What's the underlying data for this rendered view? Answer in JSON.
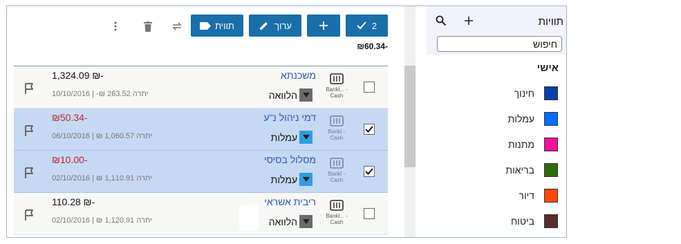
{
  "toolbar": {
    "confirm_count": "2",
    "edit_label": "ערוך",
    "tags_label": "תווית"
  },
  "total": "-₪60.34",
  "transactions": [
    {
      "payee": "משכנתא",
      "account": "Bankl... - Cash",
      "category": "הלוואה",
      "category_color": "#6b6b6b",
      "amount": "-₪ 1,324.09",
      "negative": false,
      "balance": "יתרה 263.52 ₪- | 10/10/2016",
      "checked": false,
      "selected": false
    },
    {
      "payee": "דמי ניהול נ\"ע",
      "account": "Bankl - Cash",
      "category": "עמלות",
      "category_color": "#2f9de0",
      "amount": "-₪50.34",
      "negative": true,
      "balance": "יתרה 1,060.57 ₪ | 06/10/2016",
      "checked": true,
      "selected": true
    },
    {
      "payee": "מסלול בסיסי",
      "account": "Bankl - Cash",
      "category": "עמלות",
      "category_color": "#2f9de0",
      "amount": "-₪10.00",
      "negative": true,
      "balance": "יתרה 1,110.91 ₪ | 02/10/2016",
      "checked": true,
      "selected": true
    },
    {
      "payee": "ריבית אשראי",
      "account": "Bankl... - Cash",
      "category": "הלוואה",
      "category_color": "#6b6b6b",
      "amount": "-₪ 110.28",
      "negative": false,
      "balance": "יתרה 1,120.91 ₪ | 02/10/2016",
      "checked": false,
      "selected": false
    }
  ],
  "sidebar": {
    "title": "תוויות",
    "search_value": "חיפוש",
    "group_title": "אישי",
    "tags": [
      {
        "label": "חינוך",
        "color": "#0d3ea8"
      },
      {
        "label": "עמלות",
        "color": "#0a6cff"
      },
      {
        "label": "מתנות",
        "color": "#f0129a"
      },
      {
        "label": "בריאות",
        "color": "#2f6b0c"
      },
      {
        "label": "דיור",
        "color": "#ff4a0a"
      },
      {
        "label": "ביטוח",
        "color": "#5b2b2b"
      }
    ]
  }
}
